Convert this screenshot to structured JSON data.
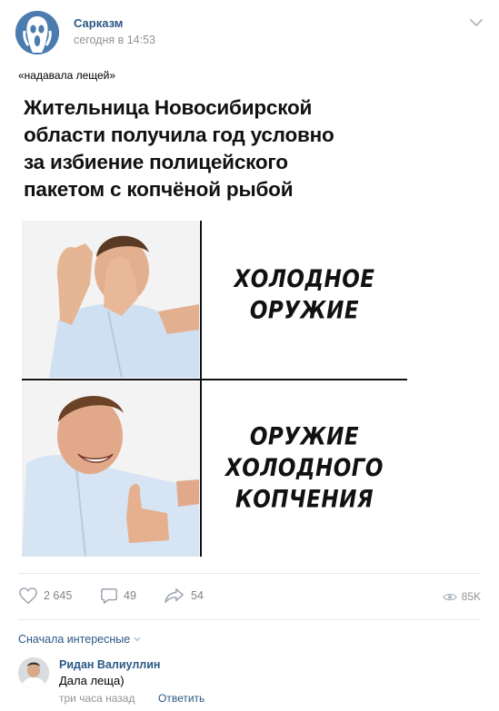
{
  "post": {
    "author": "Сарказм",
    "time": "сегодня в 14:53",
    "caption": "«надавала лещей»",
    "headline_lines": [
      "Жительница Новосибирской",
      "области получила год условно",
      "за избиение полицейского",
      "пакетом с копчёной рыбой"
    ],
    "meme": {
      "top_text": [
        "ХОЛОДНОЕ",
        "ОРУЖИЕ"
      ],
      "bottom_text": [
        "ОРУЖИЕ",
        "ХОЛОДНОГО",
        "КОПЧЕНИЯ"
      ]
    }
  },
  "actions": {
    "likes": "2 645",
    "comments": "49",
    "shares": "54",
    "views": "85K"
  },
  "comments_section": {
    "sort_label": "Сначала интересные",
    "comment": {
      "author": "Ридан Валиуллин",
      "text": "Дала леща)",
      "time": "три часа назад",
      "reply_label": "Ответить"
    }
  },
  "colors": {
    "link": "#2a5885",
    "meta": "#939393",
    "divider": "#e7e8ec",
    "icon": "#99a2ad"
  }
}
